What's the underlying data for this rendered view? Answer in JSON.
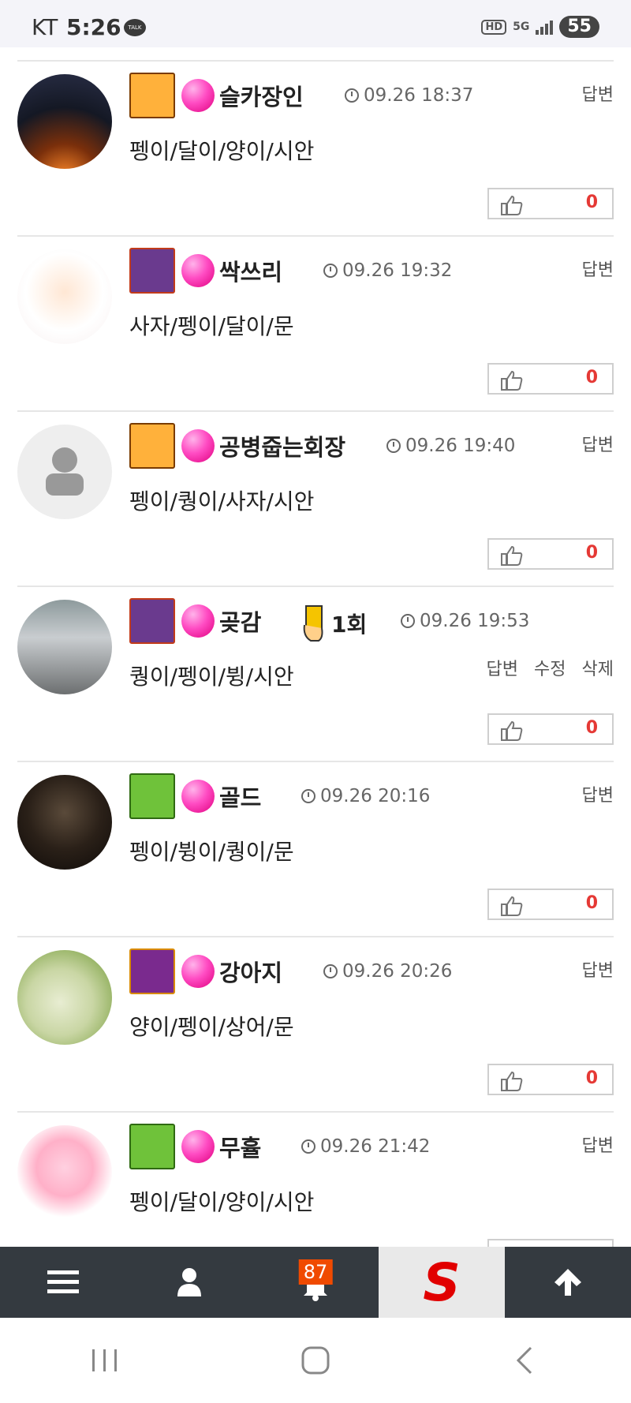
{
  "status_bar": {
    "carrier": "KT",
    "time": "5:26",
    "talk_icon": "TALK",
    "hd": "HD",
    "network": "5G",
    "battery": "55"
  },
  "comments": [
    {
      "name": "슬카장인",
      "time": "09.26 18:37",
      "text": "펭이/달이/양이/시안",
      "likes": "0",
      "actions": [
        "답변"
      ]
    },
    {
      "name": "싹쓰리",
      "time": "09.26 19:32",
      "text": "사자/펭이/달이/문",
      "likes": "0",
      "actions": [
        "답변"
      ]
    },
    {
      "name": "공병줍는회장",
      "time": "09.26 19:40",
      "text": "펭이/퀑이/사자/시안",
      "likes": "0",
      "actions": [
        "답변"
      ]
    },
    {
      "name": "곶감",
      "warning": "1회",
      "time": "09.26 19:53",
      "text": "퀑이/펭이/뷩/시안",
      "likes": "0",
      "actions": [
        "답변",
        "수정",
        "삭제"
      ]
    },
    {
      "name": "골드",
      "time": "09.26 20:16",
      "text": "펭이/뷩이/퀑이/문",
      "likes": "0",
      "actions": [
        "답변"
      ]
    },
    {
      "name": "강아지",
      "time": "09.26 20:26",
      "text": "양이/펭이/상어/문",
      "likes": "0",
      "actions": [
        "답변"
      ]
    },
    {
      "name": "무휼",
      "time": "09.26 21:42",
      "text": "펭이/달이/양이/시안",
      "likes": "",
      "actions": [
        "답변"
      ]
    }
  ],
  "bottom_nav": {
    "notification_count": "87",
    "logo_letter": "S"
  },
  "colors": {
    "like_count": "#e53935",
    "nav_bg": "#343a40",
    "badge_bg": "#f04a00",
    "level_dot": "#ff4cc3"
  }
}
